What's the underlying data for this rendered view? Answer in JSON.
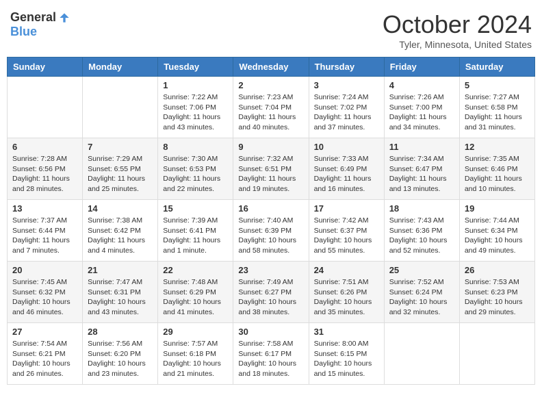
{
  "logo": {
    "general": "General",
    "blue": "Blue"
  },
  "header": {
    "month": "October 2024",
    "location": "Tyler, Minnesota, United States"
  },
  "weekdays": [
    "Sunday",
    "Monday",
    "Tuesday",
    "Wednesday",
    "Thursday",
    "Friday",
    "Saturday"
  ],
  "weeks": [
    [
      {
        "day": "",
        "info": ""
      },
      {
        "day": "",
        "info": ""
      },
      {
        "day": "1",
        "info": "Sunrise: 7:22 AM\nSunset: 7:06 PM\nDaylight: 11 hours and 43 minutes."
      },
      {
        "day": "2",
        "info": "Sunrise: 7:23 AM\nSunset: 7:04 PM\nDaylight: 11 hours and 40 minutes."
      },
      {
        "day": "3",
        "info": "Sunrise: 7:24 AM\nSunset: 7:02 PM\nDaylight: 11 hours and 37 minutes."
      },
      {
        "day": "4",
        "info": "Sunrise: 7:26 AM\nSunset: 7:00 PM\nDaylight: 11 hours and 34 minutes."
      },
      {
        "day": "5",
        "info": "Sunrise: 7:27 AM\nSunset: 6:58 PM\nDaylight: 11 hours and 31 minutes."
      }
    ],
    [
      {
        "day": "6",
        "info": "Sunrise: 7:28 AM\nSunset: 6:56 PM\nDaylight: 11 hours and 28 minutes."
      },
      {
        "day": "7",
        "info": "Sunrise: 7:29 AM\nSunset: 6:55 PM\nDaylight: 11 hours and 25 minutes."
      },
      {
        "day": "8",
        "info": "Sunrise: 7:30 AM\nSunset: 6:53 PM\nDaylight: 11 hours and 22 minutes."
      },
      {
        "day": "9",
        "info": "Sunrise: 7:32 AM\nSunset: 6:51 PM\nDaylight: 11 hours and 19 minutes."
      },
      {
        "day": "10",
        "info": "Sunrise: 7:33 AM\nSunset: 6:49 PM\nDaylight: 11 hours and 16 minutes."
      },
      {
        "day": "11",
        "info": "Sunrise: 7:34 AM\nSunset: 6:47 PM\nDaylight: 11 hours and 13 minutes."
      },
      {
        "day": "12",
        "info": "Sunrise: 7:35 AM\nSunset: 6:46 PM\nDaylight: 11 hours and 10 minutes."
      }
    ],
    [
      {
        "day": "13",
        "info": "Sunrise: 7:37 AM\nSunset: 6:44 PM\nDaylight: 11 hours and 7 minutes."
      },
      {
        "day": "14",
        "info": "Sunrise: 7:38 AM\nSunset: 6:42 PM\nDaylight: 11 hours and 4 minutes."
      },
      {
        "day": "15",
        "info": "Sunrise: 7:39 AM\nSunset: 6:41 PM\nDaylight: 11 hours and 1 minute."
      },
      {
        "day": "16",
        "info": "Sunrise: 7:40 AM\nSunset: 6:39 PM\nDaylight: 10 hours and 58 minutes."
      },
      {
        "day": "17",
        "info": "Sunrise: 7:42 AM\nSunset: 6:37 PM\nDaylight: 10 hours and 55 minutes."
      },
      {
        "day": "18",
        "info": "Sunrise: 7:43 AM\nSunset: 6:36 PM\nDaylight: 10 hours and 52 minutes."
      },
      {
        "day": "19",
        "info": "Sunrise: 7:44 AM\nSunset: 6:34 PM\nDaylight: 10 hours and 49 minutes."
      }
    ],
    [
      {
        "day": "20",
        "info": "Sunrise: 7:45 AM\nSunset: 6:32 PM\nDaylight: 10 hours and 46 minutes."
      },
      {
        "day": "21",
        "info": "Sunrise: 7:47 AM\nSunset: 6:31 PM\nDaylight: 10 hours and 43 minutes."
      },
      {
        "day": "22",
        "info": "Sunrise: 7:48 AM\nSunset: 6:29 PM\nDaylight: 10 hours and 41 minutes."
      },
      {
        "day": "23",
        "info": "Sunrise: 7:49 AM\nSunset: 6:27 PM\nDaylight: 10 hours and 38 minutes."
      },
      {
        "day": "24",
        "info": "Sunrise: 7:51 AM\nSunset: 6:26 PM\nDaylight: 10 hours and 35 minutes."
      },
      {
        "day": "25",
        "info": "Sunrise: 7:52 AM\nSunset: 6:24 PM\nDaylight: 10 hours and 32 minutes."
      },
      {
        "day": "26",
        "info": "Sunrise: 7:53 AM\nSunset: 6:23 PM\nDaylight: 10 hours and 29 minutes."
      }
    ],
    [
      {
        "day": "27",
        "info": "Sunrise: 7:54 AM\nSunset: 6:21 PM\nDaylight: 10 hours and 26 minutes."
      },
      {
        "day": "28",
        "info": "Sunrise: 7:56 AM\nSunset: 6:20 PM\nDaylight: 10 hours and 23 minutes."
      },
      {
        "day": "29",
        "info": "Sunrise: 7:57 AM\nSunset: 6:18 PM\nDaylight: 10 hours and 21 minutes."
      },
      {
        "day": "30",
        "info": "Sunrise: 7:58 AM\nSunset: 6:17 PM\nDaylight: 10 hours and 18 minutes."
      },
      {
        "day": "31",
        "info": "Sunrise: 8:00 AM\nSunset: 6:15 PM\nDaylight: 10 hours and 15 minutes."
      },
      {
        "day": "",
        "info": ""
      },
      {
        "day": "",
        "info": ""
      }
    ]
  ]
}
